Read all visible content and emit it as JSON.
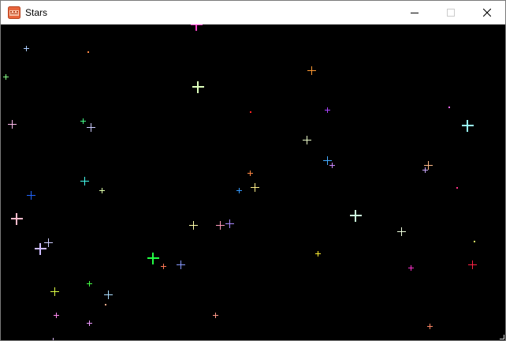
{
  "window": {
    "title": "Stars",
    "icon": "app-icon",
    "controls": [
      "minimize-icon",
      "maximize-icon",
      "close-icon"
    ]
  },
  "stars": [
    {
      "c": "#ff44cc",
      "size": "large"
    },
    {
      "c": "#aaccff",
      "size": "small"
    },
    {
      "c": "#ff8844",
      "size": "dot"
    },
    {
      "c": "#88ff88",
      "size": "small"
    },
    {
      "c": "#ddffbb",
      "size": "large"
    },
    {
      "c": "#ff9933",
      "size": "medium"
    },
    {
      "c": "#ff2222",
      "size": "dot"
    },
    {
      "c": "#aa44ff",
      "size": "small"
    },
    {
      "c": "#ff66ff",
      "size": "dot"
    },
    {
      "c": "#ffbbee",
      "size": "medium"
    },
    {
      "c": "#44ff88",
      "size": "small"
    },
    {
      "c": "#ccccff",
      "size": "medium"
    },
    {
      "c": "#eeffcc",
      "size": "medium"
    },
    {
      "c": "#99ffff",
      "size": "large"
    },
    {
      "c": "#44aaff",
      "size": "medium"
    },
    {
      "c": "#cc88ff",
      "size": "small"
    },
    {
      "c": "#ffbb88",
      "size": "medium"
    },
    {
      "c": "#ccaaff",
      "size": "small"
    },
    {
      "c": "#ff8844",
      "size": "small"
    },
    {
      "c": "#44ffee",
      "size": "medium"
    },
    {
      "c": "#ff3388",
      "size": "dot"
    },
    {
      "c": "#2266ff",
      "size": "medium"
    },
    {
      "c": "#ddffaa",
      "size": "small"
    },
    {
      "c": "#3399ff",
      "size": "small"
    },
    {
      "c": "#ffee88",
      "size": "medium"
    },
    {
      "c": "#ffbbcc",
      "size": "large"
    },
    {
      "c": "#ccffdd",
      "size": "large"
    },
    {
      "c": "#ffffaa",
      "size": "medium"
    },
    {
      "c": "#ff99bb",
      "size": "medium"
    },
    {
      "c": "#aa88ff",
      "size": "medium"
    },
    {
      "c": "#eeffdd",
      "size": "medium"
    },
    {
      "c": "#ccccff",
      "size": "medium"
    },
    {
      "c": "#ccbbff",
      "size": "large"
    },
    {
      "c": "#ddff66",
      "size": "dot"
    },
    {
      "c": "#22ff44",
      "size": "large"
    },
    {
      "c": "#ff7755",
      "size": "small"
    },
    {
      "c": "#8899ff",
      "size": "medium"
    },
    {
      "c": "#ffee33",
      "size": "small"
    },
    {
      "c": "#ff33cc",
      "size": "small"
    },
    {
      "c": "#ff2244",
      "size": "medium"
    },
    {
      "c": "#44ff44",
      "size": "small"
    },
    {
      "c": "#ddff44",
      "size": "medium"
    },
    {
      "c": "#aaddff",
      "size": "medium"
    },
    {
      "c": "#ffaa88",
      "size": "dot"
    },
    {
      "c": "#ff88ee",
      "size": "small"
    },
    {
      "c": "#ff9988",
      "size": "small"
    },
    {
      "c": "#ee99ff",
      "size": "small"
    },
    {
      "c": "#ff8866",
      "size": "small"
    },
    {
      "c": "#ddbbff",
      "size": "small"
    }
  ]
}
